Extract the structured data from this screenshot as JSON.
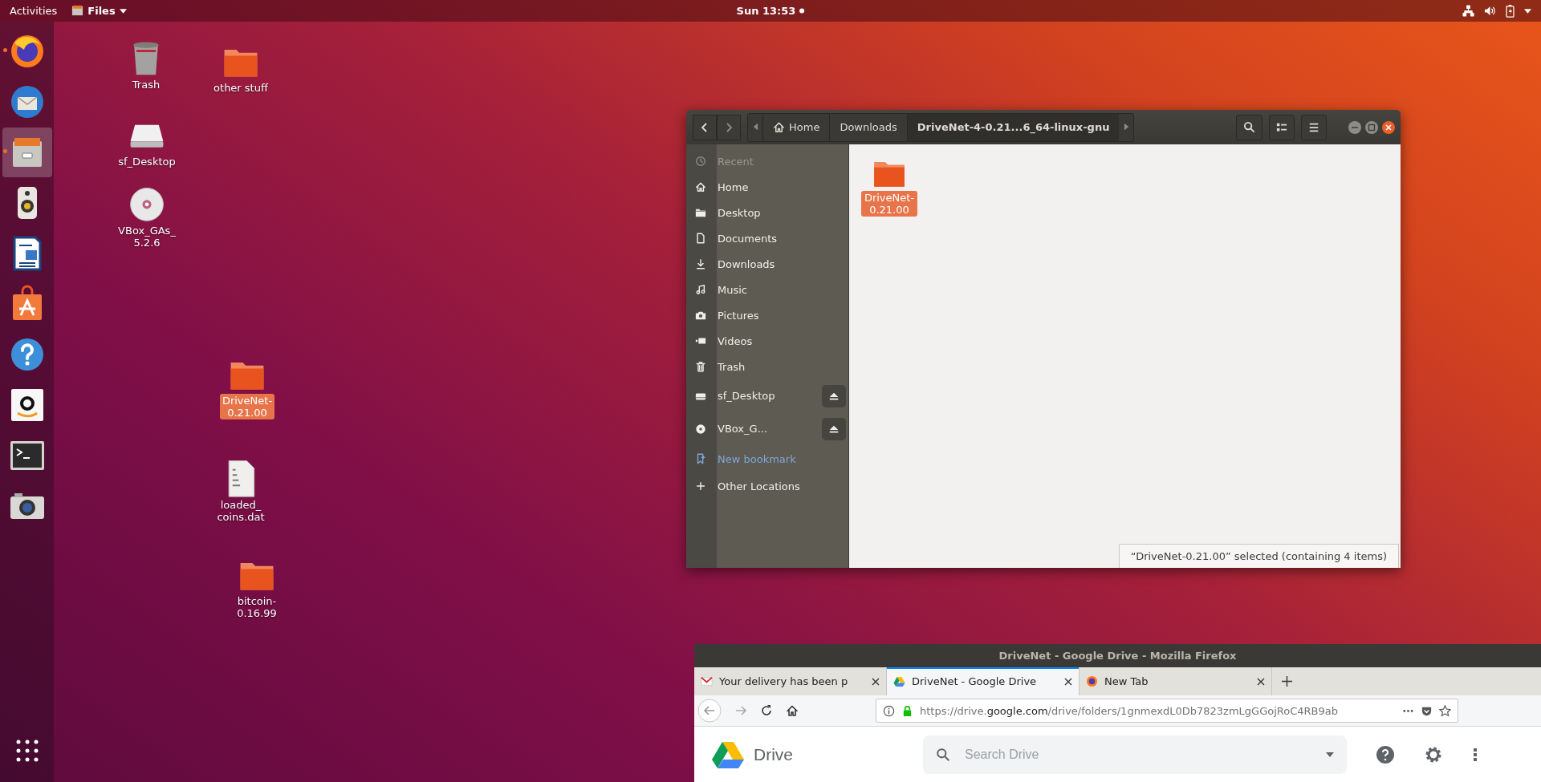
{
  "top_bar": {
    "activities": "Activities",
    "app_menu": "Files",
    "clock": "Sun 13:53",
    "notification": true
  },
  "dock": {
    "items": [
      {
        "kind": "browser",
        "running": true,
        "selected": false
      },
      {
        "kind": "mail",
        "running": false,
        "selected": false
      },
      {
        "kind": "files",
        "running": true,
        "selected": true
      },
      {
        "kind": "audio",
        "running": false,
        "selected": false
      },
      {
        "kind": "writer",
        "running": false,
        "selected": false
      },
      {
        "kind": "store",
        "running": false,
        "selected": false
      },
      {
        "kind": "help",
        "running": false,
        "selected": false
      },
      {
        "kind": "shop",
        "running": false,
        "selected": false
      },
      {
        "kind": "terminal",
        "running": false,
        "selected": false
      },
      {
        "kind": "camera",
        "running": false,
        "selected": false
      }
    ]
  },
  "desktop_icons": [
    {
      "label": "Trash",
      "kind": "trash",
      "selected": false
    },
    {
      "label": "other stuff",
      "kind": "folder",
      "selected": false
    },
    {
      "label": "sf_Desktop",
      "kind": "drive",
      "selected": false
    },
    {
      "label": "VBox_GAs_\n5.2.6",
      "kind": "disc",
      "selected": false
    },
    {
      "label": "DriveNet-\n0.21.00",
      "kind": "folder",
      "selected": true
    },
    {
      "label": "loaded_\ncoins.dat",
      "kind": "file",
      "selected": false
    },
    {
      "label": "bitcoin-\n0.16.99",
      "kind": "folder",
      "selected": false
    }
  ],
  "file_manager": {
    "path": [
      {
        "label": "Home",
        "kind": "home",
        "selected": false
      },
      {
        "label": "Downloads",
        "kind": "plain",
        "selected": false
      },
      {
        "label": "DriveNet-4-0.21...6_64-linux-gnu",
        "kind": "plain",
        "selected": true
      }
    ],
    "sidebar": {
      "items": [
        {
          "label": "Recent",
          "kind": "clock",
          "disabled": true,
          "ejectable": false
        },
        {
          "label": "Home",
          "kind": "home",
          "disabled": false,
          "ejectable": false
        },
        {
          "label": "Desktop",
          "kind": "folder",
          "disabled": false,
          "ejectable": false
        },
        {
          "label": "Documents",
          "kind": "document",
          "disabled": false,
          "ejectable": false
        },
        {
          "label": "Downloads",
          "kind": "download",
          "disabled": false,
          "ejectable": false
        },
        {
          "label": "Music",
          "kind": "music",
          "disabled": false,
          "ejectable": false
        },
        {
          "label": "Pictures",
          "kind": "camera",
          "disabled": false,
          "ejectable": false
        },
        {
          "label": "Videos",
          "kind": "video",
          "disabled": false,
          "ejectable": false
        },
        {
          "label": "Trash",
          "kind": "trash",
          "disabled": false,
          "ejectable": false
        },
        {
          "label": "sf_Desktop",
          "kind": "drive",
          "disabled": false,
          "ejectable": true
        },
        {
          "label": "VBox_G...",
          "kind": "disc",
          "disabled": false,
          "ejectable": true
        },
        {
          "label": "New bookmark",
          "kind": "bookmark",
          "disabled": false,
          "ejectable": false
        },
        {
          "label": "Other Locations",
          "kind": "plus",
          "disabled": false,
          "ejectable": false
        }
      ]
    },
    "items": [
      {
        "label": "DriveNet-\n0.21.00",
        "selected": true
      }
    ],
    "status": "“DriveNet-0.21.00” selected  (containing 4 items)"
  },
  "browser": {
    "title": "DriveNet - Google Drive - Mozilla Firefox",
    "tabs": [
      {
        "label": "Your delivery has been p",
        "kind": "mail",
        "selected": false
      },
      {
        "label": "DriveNet - Google Drive",
        "kind": "drive",
        "selected": true
      },
      {
        "label": "New Tab",
        "kind": "browser",
        "selected": false
      }
    ],
    "url": "https://drive.**google.com**/drive/folders/1gnmexdL0Db7823zmLgGGojRoC4RB9ab",
    "page": {
      "app_name": "Drive",
      "search_placeholder": "Search Drive"
    }
  }
}
